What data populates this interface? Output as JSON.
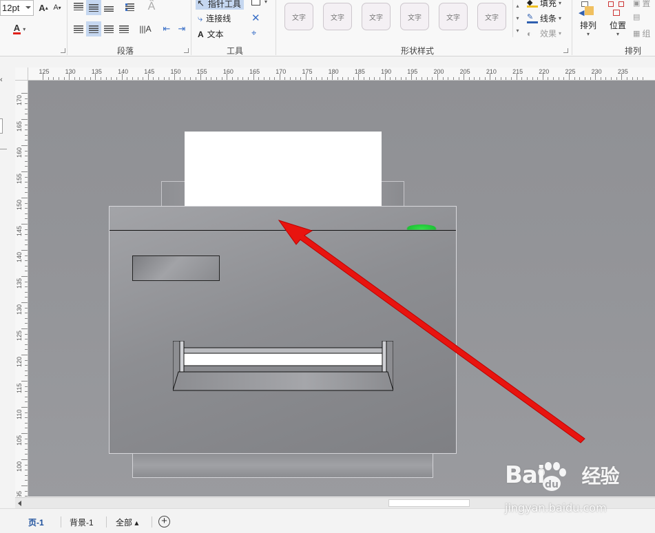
{
  "ribbon": {
    "font": {
      "size_value": "12pt",
      "grow_label": "A",
      "shrink_label": "A",
      "color_label": "A",
      "color": "#e0201a"
    },
    "paragraph": {
      "group_label": "段落"
    },
    "tools": {
      "pointer_label": "指针工具",
      "connector_label": "连接线",
      "text_label": "文本",
      "group_label": "工具"
    },
    "shape_styles": {
      "swatch_label": "文字",
      "swatches": [
        "文字",
        "文字",
        "文字",
        "文字",
        "文字",
        "文字"
      ],
      "group_label": "形状样式"
    },
    "format": {
      "fill_label": "填充",
      "line_label": "线条",
      "effect_label": "效果"
    },
    "arrange": {
      "arrange_label": "排列",
      "position_label": "位置",
      "group_label": "排列",
      "side_label_1": "置",
      "side_label_2": "组"
    }
  },
  "ruler": {
    "horizontal": [
      "125",
      "130",
      "135",
      "140",
      "145",
      "150",
      "155",
      "160",
      "165",
      "170",
      "175",
      "180",
      "185",
      "190",
      "195",
      "200",
      "205",
      "210",
      "215",
      "220",
      "225",
      "230",
      "235"
    ],
    "vertical": [
      "170",
      "165",
      "160",
      "155",
      "150",
      "145",
      "140",
      "135",
      "130",
      "125",
      "120",
      "115",
      "110",
      "105",
      "100",
      "95"
    ]
  },
  "canvas": {
    "arrow_color": "#e8140f",
    "led_color": "#1ec235"
  },
  "page_tabs": {
    "page1": "页-1",
    "background1": "背景-1",
    "all": "全部 ▴",
    "add_symbol": "+"
  },
  "watermark": {
    "logo": "Bai du 经验",
    "url": "jingyan.baidu.com"
  }
}
